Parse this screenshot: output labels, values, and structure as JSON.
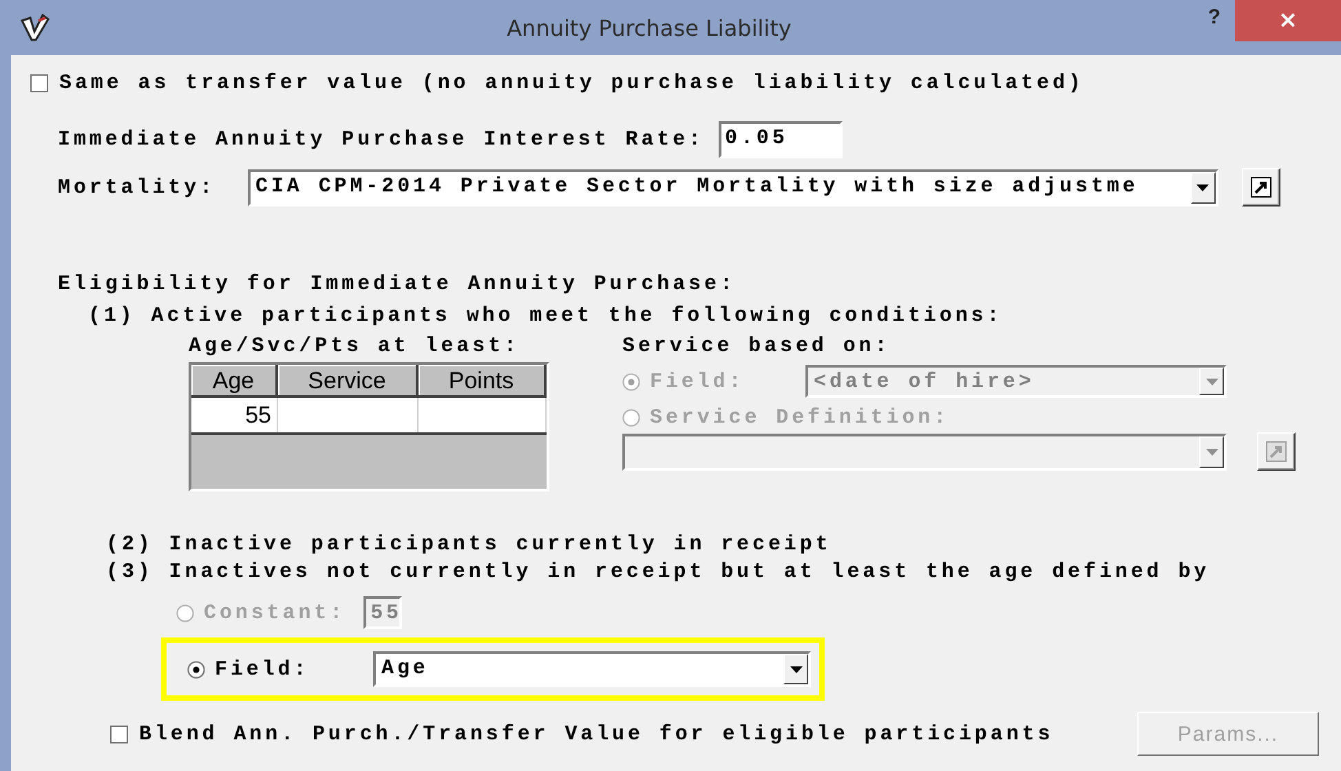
{
  "window": {
    "title": "Annuity Purchase Liability",
    "help": "?",
    "close": "×"
  },
  "same_as_transfer": {
    "label": "Same as transfer value (no annuity purchase liability calculated)",
    "checked": false
  },
  "interest_rate": {
    "label": "Immediate Annuity Purchase Interest Rate:",
    "value": "0.05"
  },
  "mortality": {
    "label": "Mortality:",
    "value": "CIA CPM-2014 Private Sector Mortality with size adjustme"
  },
  "eligibility": {
    "heading": "Eligibility for Immediate Annuity Purchase:",
    "active": {
      "label": "(1) Active participants who meet the following conditions:",
      "table_title": "Age/Svc/Pts at least:",
      "columns": [
        "Age",
        "Service",
        "Points"
      ],
      "rows": [
        [
          "55",
          "",
          ""
        ]
      ],
      "service_based_on": {
        "heading": "Service based on:",
        "options": [
          {
            "label": "Field:",
            "selected": true,
            "disabled": true,
            "kind": "dropdown",
            "value": "<date of hire>"
          },
          {
            "label": "Service Definition:",
            "selected": false,
            "disabled": true,
            "kind": "definition"
          }
        ]
      }
    },
    "in_receipt": {
      "label": "(2) Inactive participants currently in receipt"
    },
    "not_in_receipt": {
      "label": "(3) Inactives not currently in receipt but at least the age defined by",
      "options": [
        {
          "label": "Constant:",
          "selected": false,
          "kind": "text",
          "value": "55",
          "disabled": true,
          "highlighted": false
        },
        {
          "label": "Field:",
          "selected": true,
          "kind": "dropdown",
          "value": "Age",
          "disabled": false,
          "highlighted": true
        }
      ]
    }
  },
  "blend": {
    "label": "Blend Ann. Purch./Transfer Value for eligible participants",
    "checked": false
  },
  "params_button": {
    "label": "Params...",
    "disabled": true
  }
}
